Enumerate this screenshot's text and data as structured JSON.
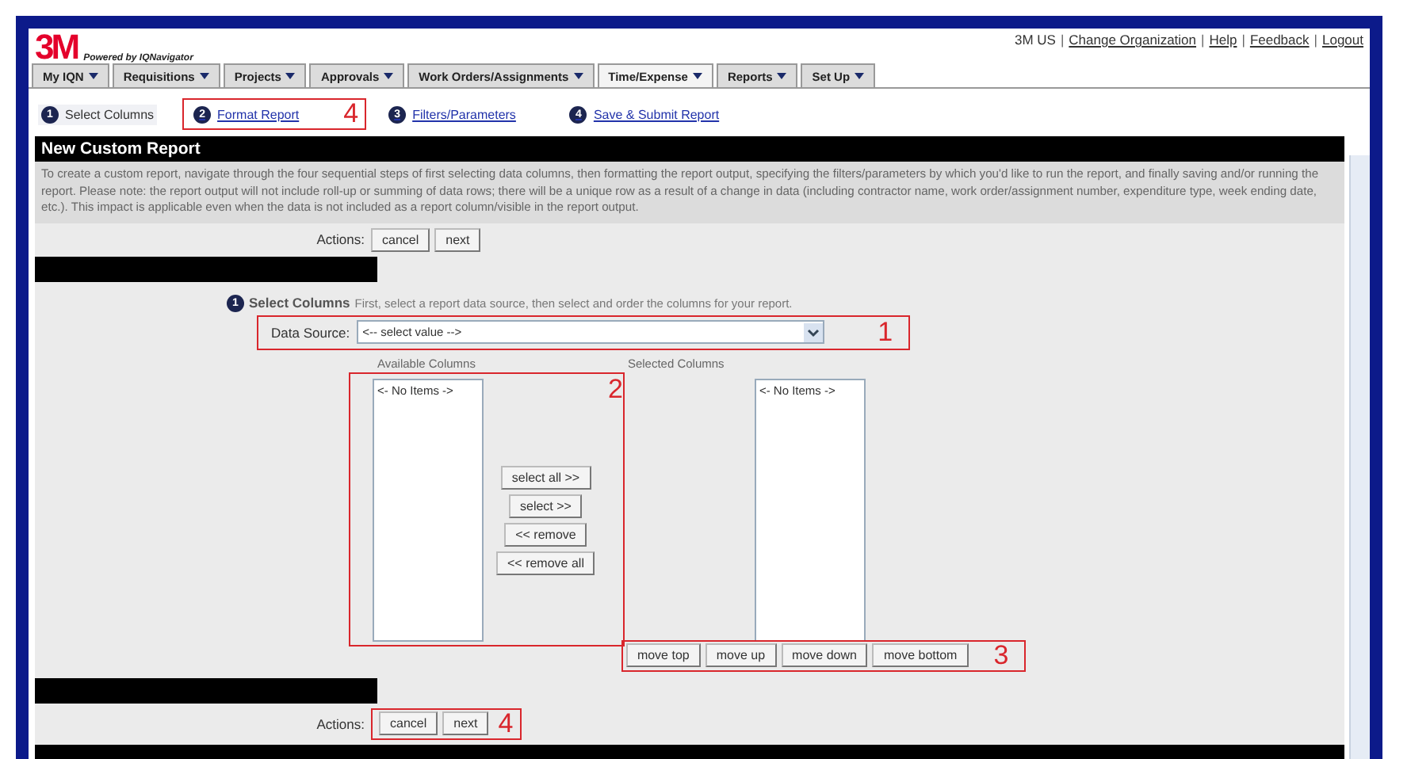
{
  "header": {
    "logo": "3M",
    "tagline": "Powered by IQNavigator",
    "separator": "|",
    "links": [
      {
        "label": "3M US",
        "link": false
      },
      {
        "label": "Change Organization",
        "link": true
      },
      {
        "label": "Help",
        "link": true
      },
      {
        "label": "Feedback",
        "link": true
      },
      {
        "label": "Logout",
        "link": true
      }
    ]
  },
  "nav": [
    {
      "label": "My IQN",
      "selected": false
    },
    {
      "label": "Requisitions",
      "selected": false
    },
    {
      "label": "Projects",
      "selected": false
    },
    {
      "label": "Approvals",
      "selected": false
    },
    {
      "label": "Work Orders/Assignments",
      "selected": false
    },
    {
      "label": "Time/Expense",
      "selected": true
    },
    {
      "label": "Reports",
      "selected": false
    },
    {
      "label": "Set Up",
      "selected": false
    }
  ],
  "steps": [
    {
      "number": "1",
      "label": "Select Columns",
      "selected": true
    },
    {
      "number": "2",
      "label": "Format Report",
      "selected": false,
      "annotation": "4"
    },
    {
      "number": "3",
      "label": "Filters/Parameters",
      "selected": false
    },
    {
      "number": "4",
      "label": "Save & Submit Report",
      "selected": false
    }
  ],
  "title": "New Custom Report",
  "description": "To create a custom report, navigate through the four sequential steps of first selecting data columns, then formatting the report output, specifying the filters/parameters by which you'd like to run the report, and finally saving and/or running the report. Please note: the report output will not include roll-up or summing of data rows; there will be a unique row as a result of a change in data (including contractor name, work order/assignment number, expenditure type, week ending date, etc.). This impact is applicable even when the data is not included as a report column/visible in the report output.",
  "top_actions": {
    "label": "Actions:",
    "buttons": [
      "cancel",
      "next"
    ]
  },
  "section": {
    "number": "1",
    "title": "Select Columns",
    "hint": "First, select a report data source, then select and order the columns for your report."
  },
  "data_source": {
    "label": "Data Source:",
    "value": "<-- select value -->",
    "annotation": "1"
  },
  "available": {
    "label": "Available Columns",
    "items": [
      "<- No Items ->"
    ],
    "annotation": "2"
  },
  "transfer_buttons": [
    "select all >>",
    "select >>",
    "<< remove",
    "<< remove all"
  ],
  "selected": {
    "label": "Selected Columns",
    "items": [
      "<- No Items ->"
    ]
  },
  "order_buttons": {
    "buttons": [
      "move top",
      "move up",
      "move down",
      "move bottom"
    ],
    "annotation": "3"
  },
  "bottom_actions": {
    "label": "Actions:",
    "buttons": [
      "cancel",
      "next"
    ],
    "annotation": "4"
  }
}
